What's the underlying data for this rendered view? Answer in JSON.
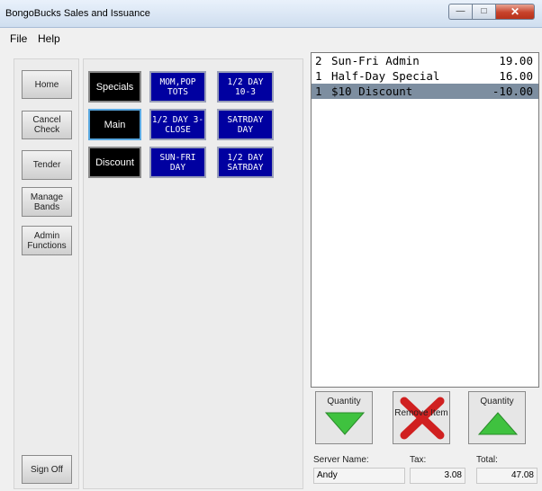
{
  "window": {
    "title": "BongoBucks Sales and Issuance"
  },
  "menu": {
    "items": [
      "File",
      "Help"
    ]
  },
  "nav": {
    "buttons": [
      "Home",
      "Cancel Check",
      "Tender",
      "Manage Bands",
      "Admin Functions",
      "Sign Off"
    ]
  },
  "categories": [
    "Specials",
    "Main",
    "Discount"
  ],
  "items": [
    [
      "MOM,POP TOTS",
      "1/2 DAY 10-3"
    ],
    [
      "1/2 DAY 3-CLOSE",
      "SATRDAY DAY"
    ],
    [
      "SUN-FRI DAY",
      "1/2 DAY SATRDAY"
    ]
  ],
  "order": {
    "rows": [
      {
        "qty": "2",
        "name": "Sun-Fri Admin",
        "price": "19.00"
      },
      {
        "qty": "1",
        "name": "Half-Day Special",
        "price": "16.00"
      },
      {
        "qty": "1",
        "name": "$10 Discount",
        "price": "-10.00",
        "selected": true
      }
    ]
  },
  "actions": {
    "qty_down": "Quantity",
    "remove": "Remove Item",
    "qty_up": "Quantity"
  },
  "footer": {
    "server_label": "Server Name:",
    "server_value": "Andy",
    "tax_label": "Tax:",
    "tax_value": "3.08",
    "total_label": "Total:",
    "total_value": "47.08"
  },
  "colors": {
    "item_button": "#0000a0",
    "category_button": "#000000",
    "selected_row": "#7d8ea0",
    "arrow_green": "#3fc23f",
    "remove_red": "#d02020"
  }
}
